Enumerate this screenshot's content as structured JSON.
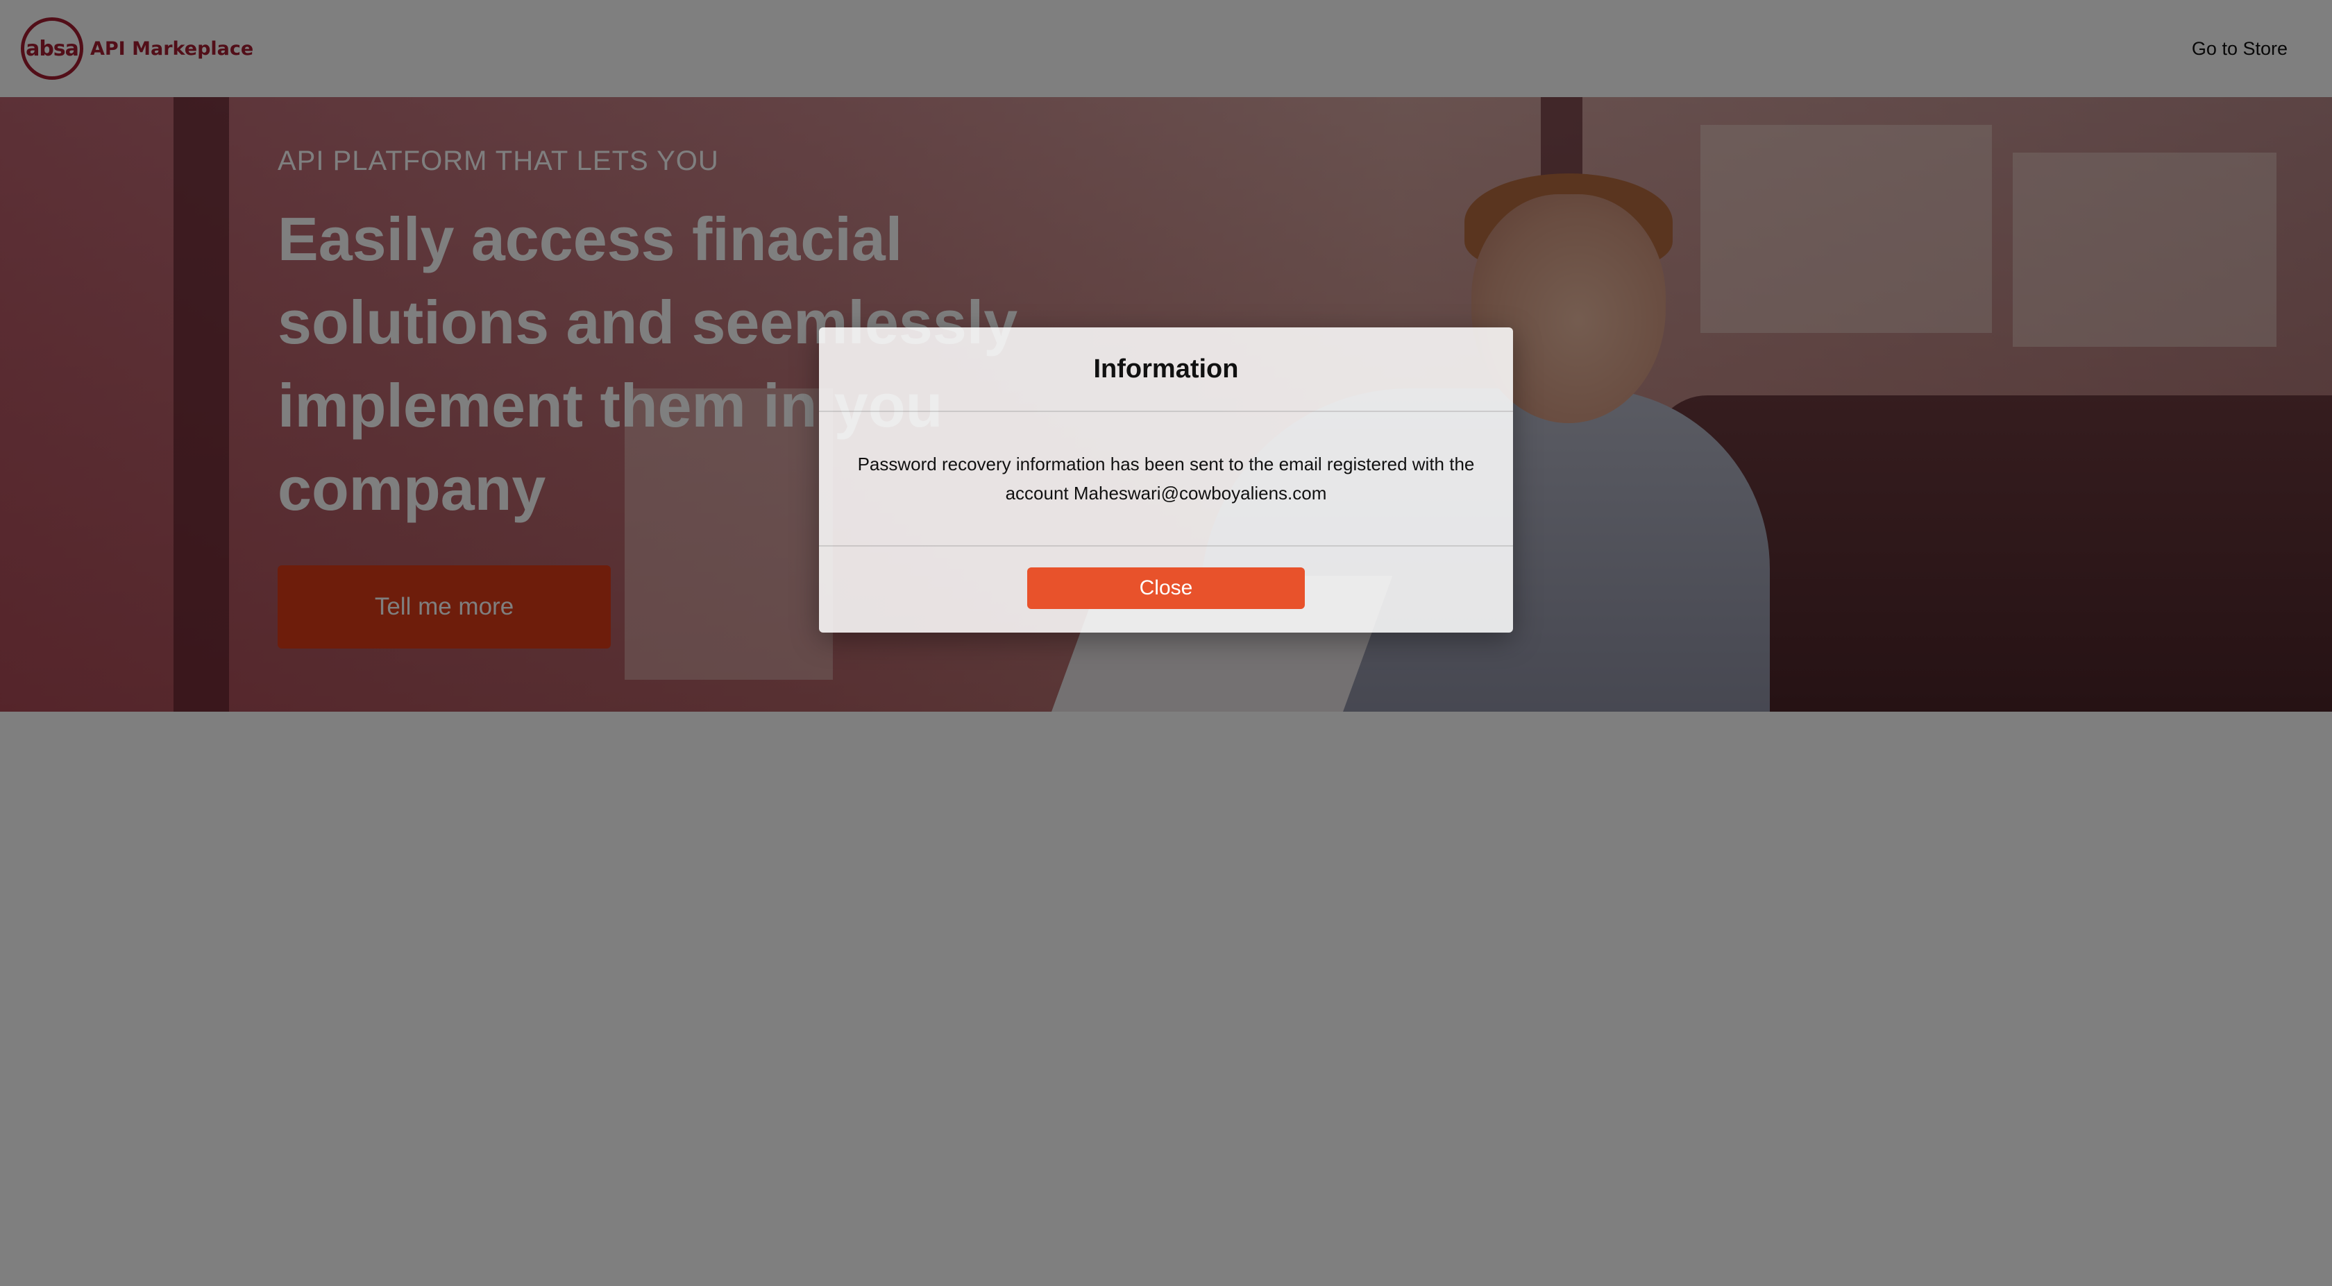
{
  "header": {
    "logo_text": "absa",
    "brand_name": "API Markeplace",
    "store_link": "Go to Store"
  },
  "hero": {
    "eyebrow": "API PLATFORM THAT LETS YOU",
    "title": "Easily access finacial solutions and seemlessly implement them in you company",
    "cta_label": "Tell me more"
  },
  "modal": {
    "title": "Information",
    "message": "Password recovery information has been sent to the email registered with the account  Maheswari@cowboyaliens.com",
    "close_label": "Close"
  },
  "colors": {
    "brand": "#a51c30",
    "cta": "#dc3a17",
    "close_button": "#e8522b"
  }
}
